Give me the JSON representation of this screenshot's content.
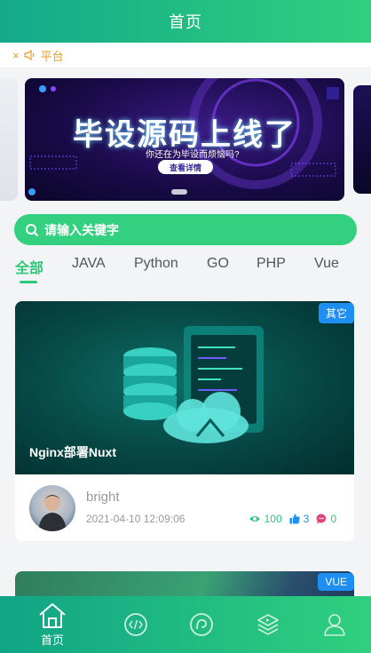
{
  "header": {
    "title": "首页"
  },
  "notice": {
    "close": "×",
    "text": "平台"
  },
  "banner": {
    "title": "毕设源码上线了",
    "subtitle": "你还在为毕设而烦恼吗?",
    "button_label": "查看详情"
  },
  "search": {
    "placeholder": "请输入关键字"
  },
  "tabs": [
    {
      "label": "全部",
      "active": true
    },
    {
      "label": "JAVA"
    },
    {
      "label": "Python"
    },
    {
      "label": "GO"
    },
    {
      "label": "PHP"
    },
    {
      "label": "Vue"
    }
  ],
  "posts": [
    {
      "title": "Nginx部署Nuxt",
      "category": "其它",
      "author": "bright",
      "date": "2021-04-10 12:09:06",
      "views": "100",
      "likes": "3",
      "comments": "0"
    },
    {
      "category": "VUE"
    }
  ],
  "tabbar": {
    "items": [
      {
        "label": "首页",
        "active": true
      }
    ]
  },
  "colors": {
    "primary": "#2ec77a",
    "badge": "#1f8ef1",
    "notice": "#e39c2d"
  }
}
